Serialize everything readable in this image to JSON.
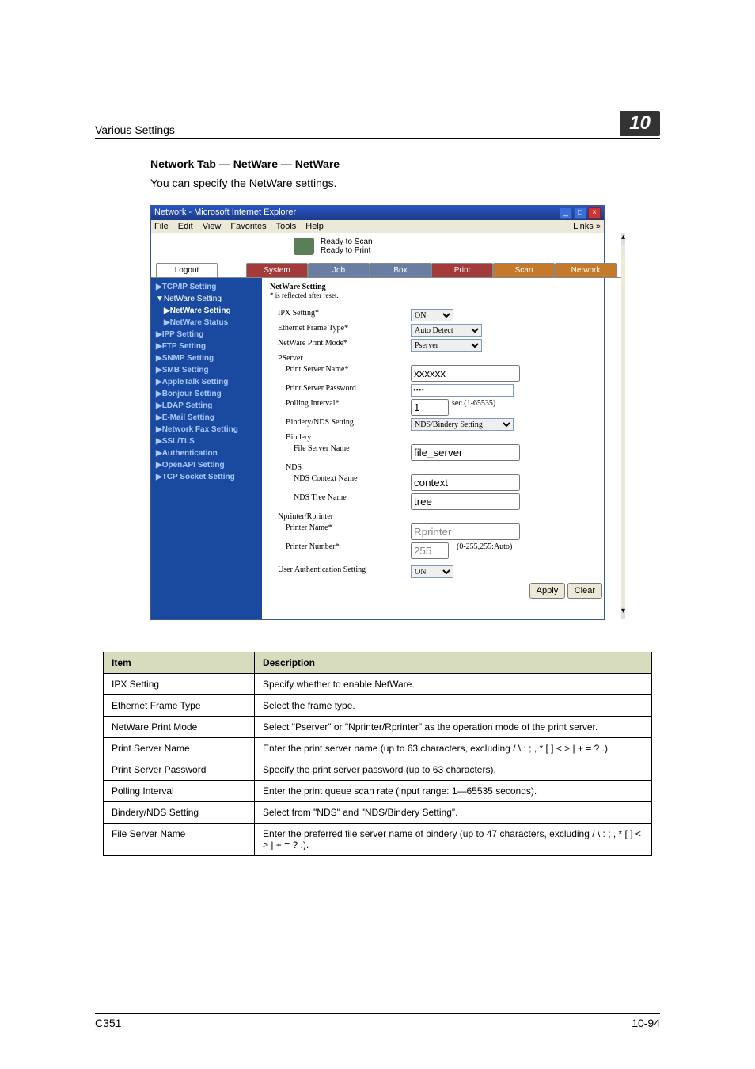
{
  "header": {
    "left": "Various Settings",
    "right": "10"
  },
  "section": {
    "title": "Network Tab — NetWare — NetWare",
    "desc": "You can specify the NetWare settings."
  },
  "ie": {
    "title": "Network - Microsoft Internet Explorer",
    "menu": {
      "file": "File",
      "edit": "Edit",
      "view": "View",
      "favorites": "Favorites",
      "tools": "Tools",
      "help": "Help",
      "links": "Links"
    },
    "status": {
      "scan": "Ready to Scan",
      "print": "Ready to Print"
    },
    "tabs": {
      "logout": "Logout",
      "system": "System",
      "job": "Job",
      "box": "Box",
      "print": "Print",
      "scan": "Scan",
      "network": "Network"
    },
    "sidebar": [
      "▶TCP/IP Setting",
      "▼NetWare Setting",
      "▶NetWare Setting",
      "▶NetWare Status",
      "▶IPP Setting",
      "▶FTP Setting",
      "▶SNMP Setting",
      "▶SMB Setting",
      "▶AppleTalk Setting",
      "▶Bonjour Setting",
      "▶LDAP Setting",
      "▶E-Mail Setting",
      "▶Network Fax Setting",
      "▶SSL/TLS",
      "▶Authentication",
      "▶OpenAPI Setting",
      "▶TCP Socket Setting"
    ],
    "main": {
      "heading": "NetWare Setting",
      "note": "* is reflected after reset.",
      "ipx_label": "IPX Setting*",
      "ipx_value": "ON",
      "frame_label": "Ethernet Frame Type*",
      "frame_value": "Auto Detect",
      "mode_label": "NetWare Print Mode*",
      "mode_value": "Pserver",
      "pserver": "PServer",
      "pname_label": "Print Server Name*",
      "pname_value": "xxxxxx",
      "ppwd_label": "Print Server Password",
      "ppwd_value": "••••",
      "poll_label": "Polling Interval*",
      "poll_value": "1",
      "poll_unit": "sec.(1-65535)",
      "bnds_label": "Bindery/NDS Setting",
      "bnds_value": "NDS/Bindery Setting",
      "bindery": "Bindery",
      "fsn_label": "File Server Name",
      "fsn_value": "file_server",
      "nds": "NDS",
      "ctx_label": "NDS Context Name",
      "ctx_value": "context",
      "tree_label": "NDS Tree Name",
      "tree_value": "tree",
      "nprinter": "Nprinter/Rprinter",
      "prn_label": "Printer Name*",
      "prn_value": "Rprinter",
      "pno_label": "Printer Number*",
      "pno_value": "255",
      "pno_unit": "(0-255,255:Auto)",
      "uauth_label": "User Authentication Setting",
      "uauth_value": "ON",
      "apply": "Apply",
      "clear": "Clear"
    }
  },
  "table": {
    "headers": {
      "item": "Item",
      "desc": "Description"
    },
    "rows": [
      {
        "item": "IPX Setting",
        "desc": "Specify whether to enable NetWare."
      },
      {
        "item": "Ethernet Frame Type",
        "desc": "Select the frame type."
      },
      {
        "item": "NetWare Print Mode",
        "desc": "Select \"Pserver\" or \"Nprinter/Rprinter\" as the operation mode of the print server."
      },
      {
        "item": "Print Server Name",
        "desc": "Enter the print server name (up to 63 characters, excluding / \\ : ; , * [ ] < > | + = ? .)."
      },
      {
        "item": "Print Server Password",
        "desc": "Specify the print server password (up to 63 characters)."
      },
      {
        "item": "Polling Interval",
        "desc": "Enter the print queue scan rate (input range: 1—65535 seconds)."
      },
      {
        "item": "Bindery/NDS Setting",
        "desc": "Select from \"NDS\" and \"NDS/Bindery Setting\"."
      },
      {
        "item": "File Server Name",
        "desc": "Enter the preferred file server name of bindery (up to 47 characters, excluding / \\ : ; , * [ ] < > | + = ? .)."
      }
    ]
  },
  "footer": {
    "left": "C351",
    "right": "10-94"
  }
}
